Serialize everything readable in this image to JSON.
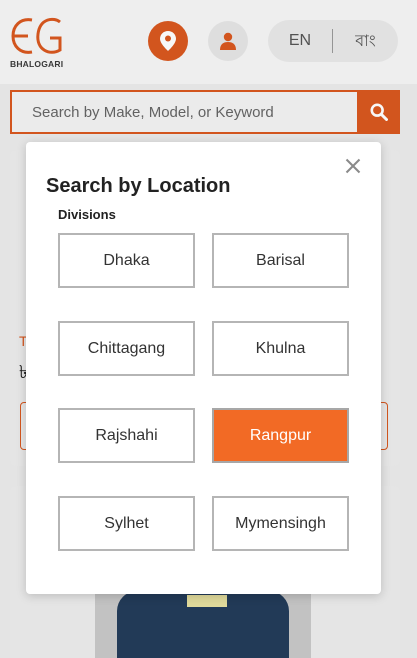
{
  "header": {
    "brand_name": "BHALOGARI",
    "language": {
      "en_label": "EN",
      "bn_label": "বাং"
    },
    "location_icon": "map-pin-icon",
    "user_icon": "user-icon"
  },
  "search": {
    "placeholder": "Search by Make, Model, or Keyword",
    "icon": "search-icon"
  },
  "background_listing": {
    "label": "T",
    "price": "৳"
  },
  "modal": {
    "title": "Search by Location",
    "section_label": "Divisions",
    "close_icon": "close-icon",
    "divisions": [
      {
        "label": "Dhaka",
        "selected": false
      },
      {
        "label": "Barisal",
        "selected": false
      },
      {
        "label": "Chittagang",
        "selected": false
      },
      {
        "label": "Khulna",
        "selected": false
      },
      {
        "label": "Rajshahi",
        "selected": false
      },
      {
        "label": "Rangpur",
        "selected": true
      },
      {
        "label": "Sylhet",
        "selected": false
      },
      {
        "label": "Mymensingh",
        "selected": false
      }
    ]
  },
  "colors": {
    "brand_orange": "#d9581f",
    "selected_orange": "#f26a25"
  }
}
